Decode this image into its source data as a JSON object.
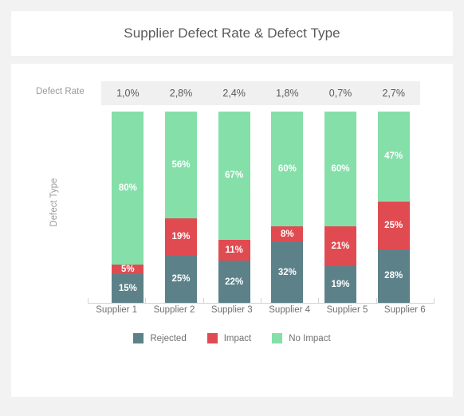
{
  "header": {
    "title": "Supplier Defect Rate & Defect Type"
  },
  "rate_row": {
    "label": "Defect Rate",
    "values": [
      "1,0%",
      "2,8%",
      "2,4%",
      "1,8%",
      "0,7%",
      "2,7%"
    ]
  },
  "axes": {
    "y_label": "Defect Type",
    "x_labels": [
      "Supplier 1",
      "Supplier 2",
      "Supplier 3",
      "Supplier 4",
      "Supplier 5",
      "Supplier 6"
    ]
  },
  "legend": {
    "items": [
      {
        "label": "Rejected",
        "color": "#5d8189"
      },
      {
        "label": "Impact",
        "color": "#e04b52"
      },
      {
        "label": "No Impact",
        "color": "#85dfa9"
      }
    ]
  },
  "colors": {
    "rejected": "#5d8189",
    "impact": "#e04b52",
    "no_impact": "#85dfa9",
    "page_background": "#f2f2f3",
    "card_background": "#ffffff",
    "band_background": "#f0f0f0",
    "title_text": "#58595b",
    "muted_text": "#9a9a9c"
  },
  "bar_labels": {
    "supplier1": {
      "rejected": "15%",
      "impact": "5%",
      "no_impact": "80%"
    },
    "supplier2": {
      "rejected": "25%",
      "impact": "19%",
      "no_impact": "56%"
    },
    "supplier3": {
      "rejected": "22%",
      "impact": "11%",
      "no_impact": "67%"
    },
    "supplier4": {
      "rejected": "32%",
      "impact": "8%",
      "no_impact": "60%"
    },
    "supplier5": {
      "rejected": "19%",
      "impact": "21%",
      "no_impact": "60%"
    },
    "supplier6": {
      "rejected": "28%",
      "impact": "25%",
      "no_impact": "47%"
    }
  },
  "chart_data": {
    "type": "bar",
    "stacked": true,
    "stack_mode": "percent",
    "title": "Supplier Defect Rate & Defect Type",
    "xlabel": "",
    "ylabel": "Defect Type",
    "categories": [
      "Supplier 1",
      "Supplier 2",
      "Supplier 3",
      "Supplier 4",
      "Supplier 5",
      "Supplier 6"
    ],
    "series": [
      {
        "name": "Rejected",
        "color": "#5d8189",
        "values": [
          15,
          25,
          22,
          32,
          19,
          28
        ]
      },
      {
        "name": "Impact",
        "color": "#e04b52",
        "values": [
          5,
          19,
          11,
          8,
          21,
          25
        ]
      },
      {
        "name": "No Impact",
        "color": "#85dfa9",
        "values": [
          80,
          56,
          67,
          60,
          60,
          47
        ]
      }
    ],
    "secondary_row": {
      "name": "Defect Rate",
      "values": [
        1.0,
        2.8,
        2.4,
        1.8,
        0.7,
        2.7
      ],
      "display": [
        "1,0%",
        "2,8%",
        "2,4%",
        "1,8%",
        "0,7%",
        "2,7%"
      ],
      "unit": "%"
    },
    "ylim": [
      0,
      100
    ],
    "grid": false,
    "legend_position": "bottom",
    "data_labels": true
  }
}
